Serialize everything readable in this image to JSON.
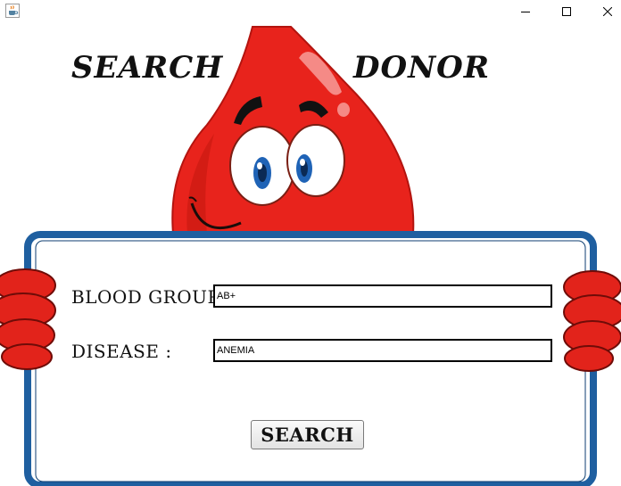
{
  "window": {
    "minimize_icon": "minimize-icon",
    "maximize_icon": "maximize-icon",
    "close_icon": "close-icon",
    "app_icon": "java-coffee-cup-icon"
  },
  "header": {
    "word_left": "SEARCH",
    "word_right": "DONOR"
  },
  "illustration": {
    "subject": "blood-drop-mascot",
    "colors": {
      "drop": "#e8231c",
      "frame": "#1f5fa0",
      "hand": "#d8201a"
    }
  },
  "form": {
    "blood_group_label": "BLOOD GROUP:",
    "blood_group_value": "AB+",
    "disease_label": "DISEASE :",
    "disease_value": "ANEMIA",
    "search_button": "SEARCH"
  }
}
